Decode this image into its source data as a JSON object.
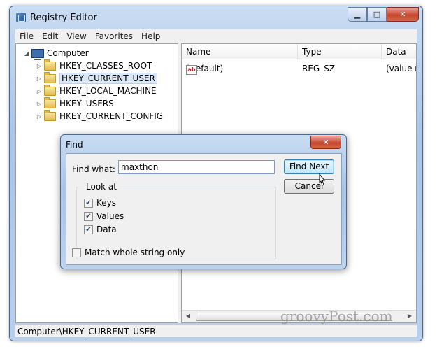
{
  "window": {
    "title": "Registry Editor",
    "minimize": "▁",
    "maximize": "□",
    "close": "✕"
  },
  "menu": [
    "File",
    "Edit",
    "View",
    "Favorites",
    "Help"
  ],
  "tree": {
    "root": "Computer",
    "children": [
      "HKEY_CLASSES_ROOT",
      "HKEY_CURRENT_USER",
      "HKEY_LOCAL_MACHINE",
      "HKEY_USERS",
      "HKEY_CURRENT_CONFIG"
    ],
    "selected": "HKEY_CURRENT_USER"
  },
  "list": {
    "columns": [
      "Name",
      "Type",
      "Data"
    ],
    "rows": [
      {
        "icon": "ab",
        "name": "(Default)",
        "type": "REG_SZ",
        "data": "(value n"
      }
    ]
  },
  "status": "Computer\\HKEY_CURRENT_USER",
  "watermark": "groovyPost.com",
  "find_dialog": {
    "title": "Find",
    "close": "✕",
    "find_what_label": "Find what:",
    "find_what_value": "maxthon",
    "find_next": "Find Next",
    "cancel": "Cancel",
    "look_at": "Look at",
    "keys": "Keys",
    "values": "Values",
    "data": "Data",
    "match_whole": "Match whole string only",
    "keys_checked": true,
    "values_checked": true,
    "data_checked": true,
    "match_checked": false
  }
}
